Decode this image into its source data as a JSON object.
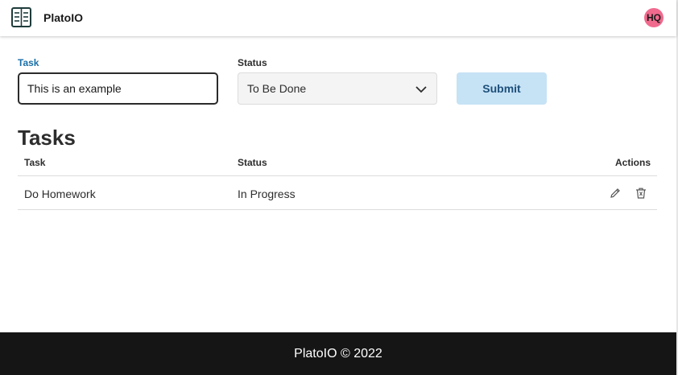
{
  "header": {
    "brand": "PlatoIO",
    "logo_icon": "list-document-icon",
    "avatar_initials": "HQ",
    "avatar_color": "#f06a8d"
  },
  "form": {
    "task_label": "Task",
    "task_value": "This is an example",
    "status_label": "Status",
    "status_value": "To Be Done",
    "submit_label": "Submit"
  },
  "tasks": {
    "heading": "Tasks",
    "columns": [
      "Task",
      "Status",
      "Actions"
    ],
    "rows": [
      {
        "task": "Do Homework",
        "status": "In Progress",
        "actions": [
          "edit-icon",
          "delete-icon"
        ]
      }
    ]
  },
  "footer": {
    "text": "PlatoIO © 2022"
  },
  "colors": {
    "accent": "#1a6fa8",
    "submit_bg": "#c6e2f5",
    "footer_bg": "#151515"
  }
}
